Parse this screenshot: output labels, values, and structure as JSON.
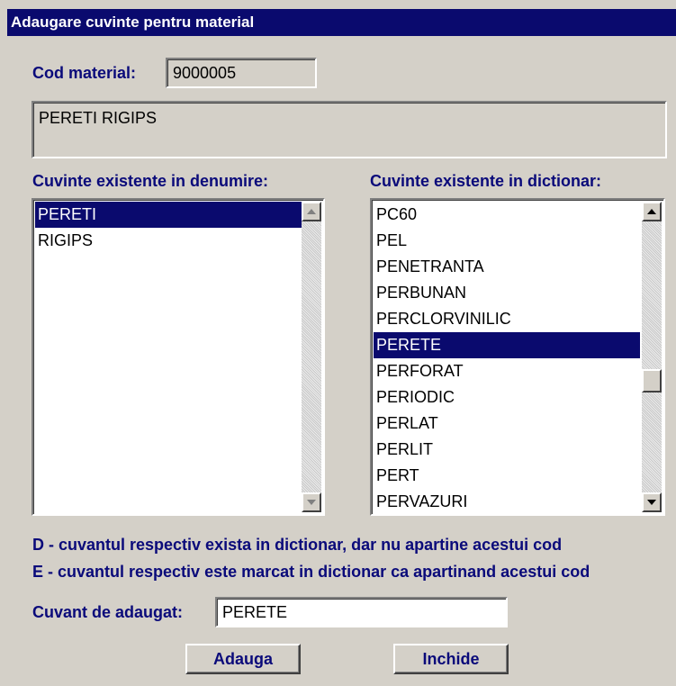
{
  "window": {
    "title": "Adaugare cuvinte pentru material"
  },
  "cod_material": {
    "label": "Cod material:",
    "value": "9000005"
  },
  "denumire": {
    "value": "PERETI RIGIPS"
  },
  "left_list": {
    "label": "Cuvinte existente in denumire:",
    "items": [
      "PERETI",
      "RIGIPS"
    ],
    "selected_index": 0
  },
  "right_list": {
    "label": "Cuvinte existente in dictionar:",
    "items": [
      "PC60",
      "PEL",
      "PENETRANTA",
      "PERBUNAN",
      "PERCLORVINILIC",
      "PERETE",
      "PERFORAT",
      "PERIODIC",
      "PERLAT",
      "PERLIT",
      "PERT",
      "PERVAZURI"
    ],
    "selected_index": 5
  },
  "legend": {
    "d": "D - cuvantul respectiv exista in dictionar, dar nu apartine acestui cod",
    "e": "E - cuvantul respectiv este marcat in dictionar ca apartinand acestui cod"
  },
  "cuvant": {
    "label": "Cuvant de adaugat:",
    "value": "PERETE"
  },
  "buttons": {
    "add": "Adauga",
    "close": "Inchide"
  },
  "icons": {
    "scroll_up": "up-arrow-icon",
    "scroll_down": "down-arrow-icon"
  },
  "colors": {
    "title_bar": "#0a0a6e",
    "label_text": "#0a0a7a",
    "selection": "#0a0a6e",
    "background": "#d4d0c8"
  }
}
